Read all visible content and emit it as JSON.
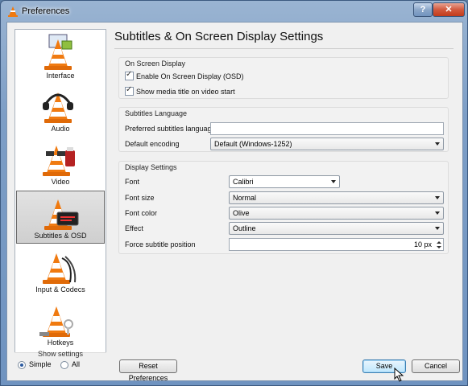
{
  "window": {
    "title": "Preferences",
    "help_label": "?",
    "close_label": "✕"
  },
  "sidebar": {
    "items": [
      {
        "label": "Interface",
        "icon": "cone-interface-icon"
      },
      {
        "label": "Audio",
        "icon": "cone-headphones-icon"
      },
      {
        "label": "Video",
        "icon": "cone-glasses-icon"
      },
      {
        "label": "Subtitles & OSD",
        "icon": "cone-subtitles-icon",
        "selected": true
      },
      {
        "label": "Input & Codecs",
        "icon": "cone-cables-icon"
      },
      {
        "label": "Hotkeys",
        "icon": "cone-keys-icon"
      }
    ]
  },
  "show_settings": {
    "title": "Show settings",
    "simple": "Simple",
    "all": "All",
    "selected": "Simple"
  },
  "header": {
    "title": "Subtitles & On Screen Display Settings"
  },
  "osd": {
    "title": "On Screen Display",
    "enable_osd": {
      "label": "Enable On Screen Display (OSD)",
      "checked": true
    },
    "show_media_title": {
      "label": "Show media title on video start",
      "checked": true
    }
  },
  "subs_lang": {
    "title": "Subtitles Language",
    "preferred_label": "Preferred subtitles language",
    "preferred_value": "",
    "encoding_label": "Default encoding",
    "encoding_value": "Default (Windows-1252)"
  },
  "display": {
    "title": "Display Settings",
    "font_label": "Font",
    "font_value": "Calibri",
    "size_label": "Font size",
    "size_value": "Normal",
    "color_label": "Font color",
    "color_value": "Olive",
    "effect_label": "Effect",
    "effect_value": "Outline",
    "position_label": "Force subtitle position",
    "position_value": "10 px"
  },
  "buttons": {
    "reset": "Reset Preferences",
    "save": "Save",
    "cancel": "Cancel"
  },
  "colors": {
    "accent": "#3c7fb1",
    "cone_orange": "#f07a10"
  }
}
